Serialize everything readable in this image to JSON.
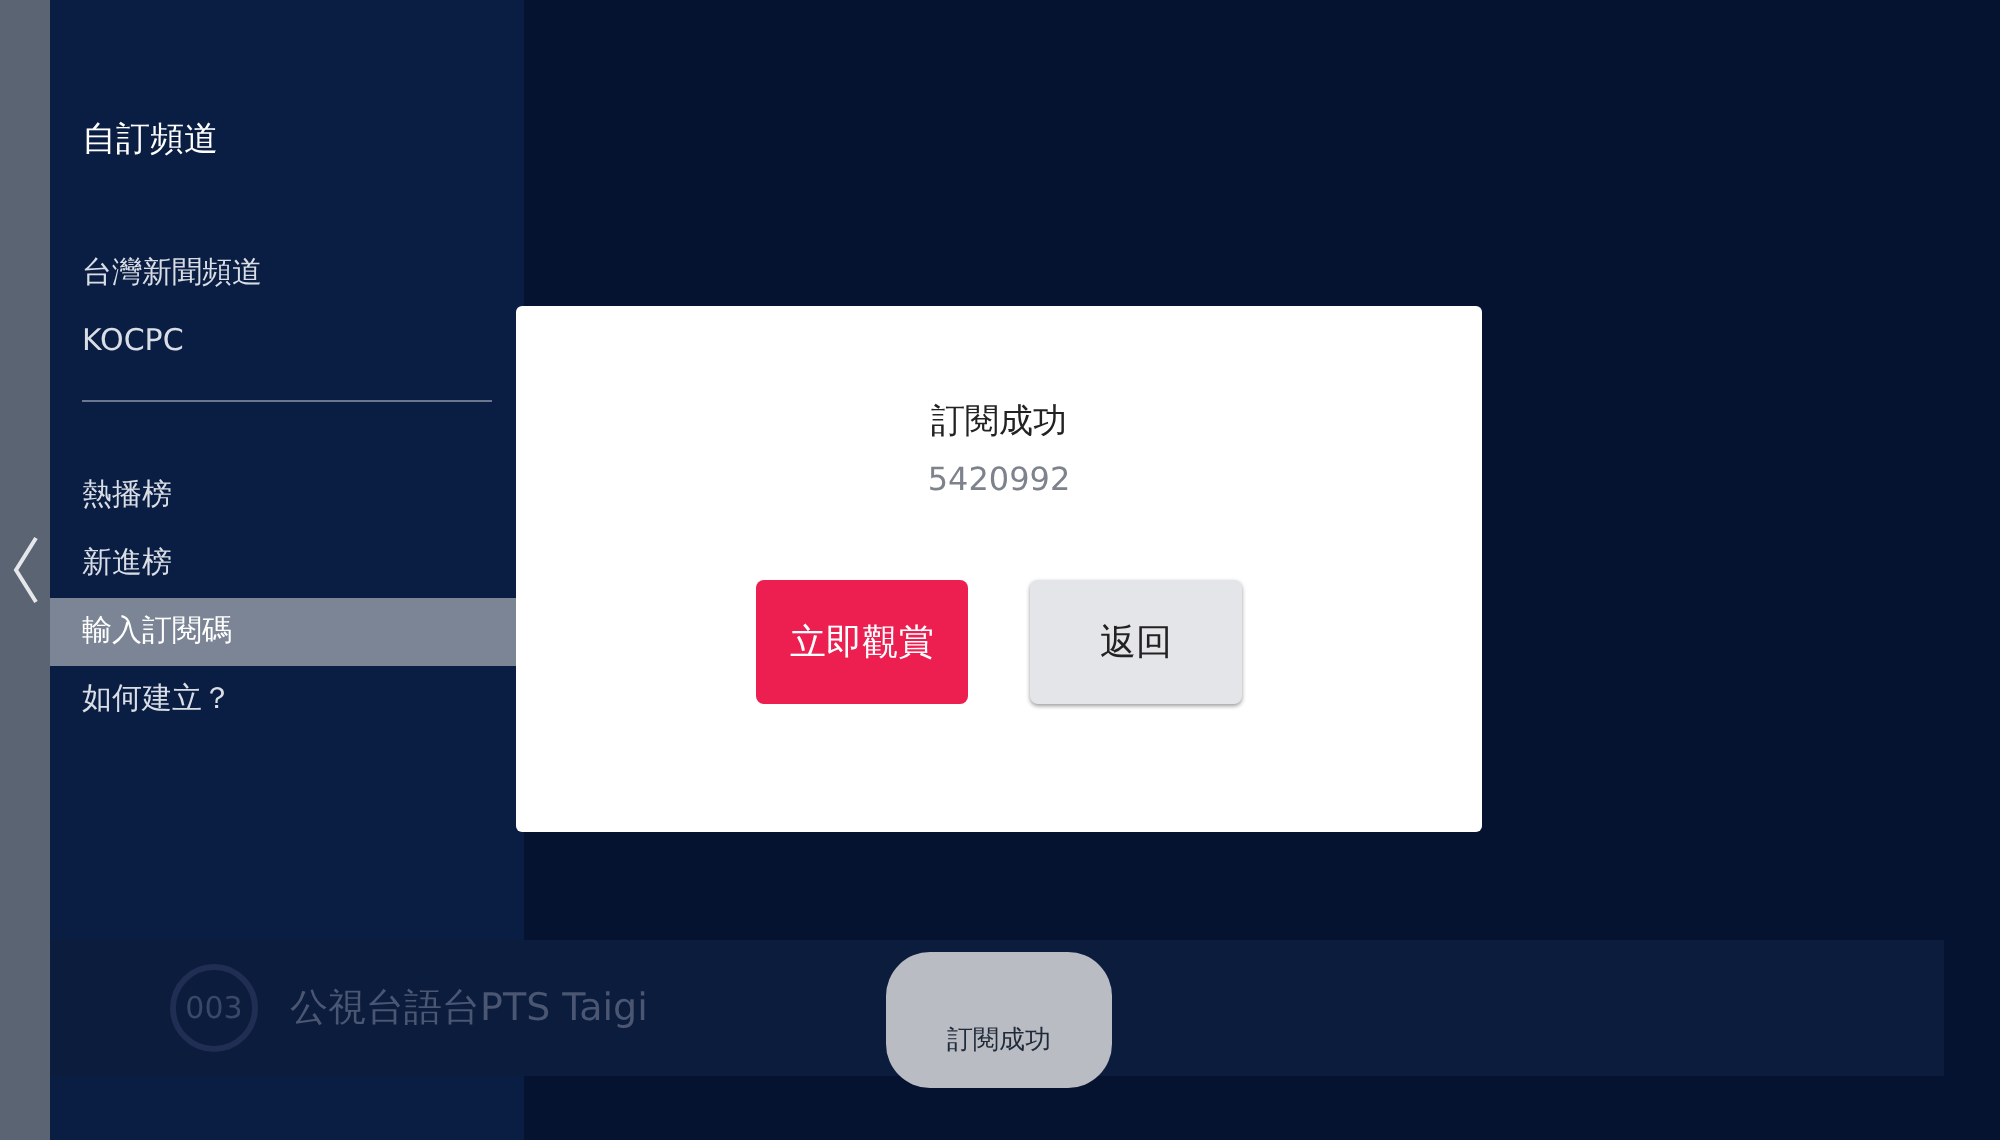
{
  "sidebar": {
    "title": "自訂頻道",
    "channels": [
      {
        "label": "台灣新聞頻道"
      },
      {
        "label": "KOCPC"
      }
    ],
    "menu": [
      {
        "label": "熱播榜",
        "selected": false
      },
      {
        "label": "新進榜",
        "selected": false
      },
      {
        "label": "輸入訂閱碼",
        "selected": true
      },
      {
        "label": "如何建立？",
        "selected": false
      }
    ]
  },
  "channel_row": {
    "number": "003",
    "name": "公視台語台PTS Taigi"
  },
  "dialog": {
    "title": "訂閱成功",
    "code": "5420992",
    "buttons": [
      {
        "label": "立即觀賞",
        "kind": "primary"
      },
      {
        "label": "返回",
        "kind": "secondary"
      }
    ]
  },
  "toast": {
    "message": "訂閱成功"
  }
}
